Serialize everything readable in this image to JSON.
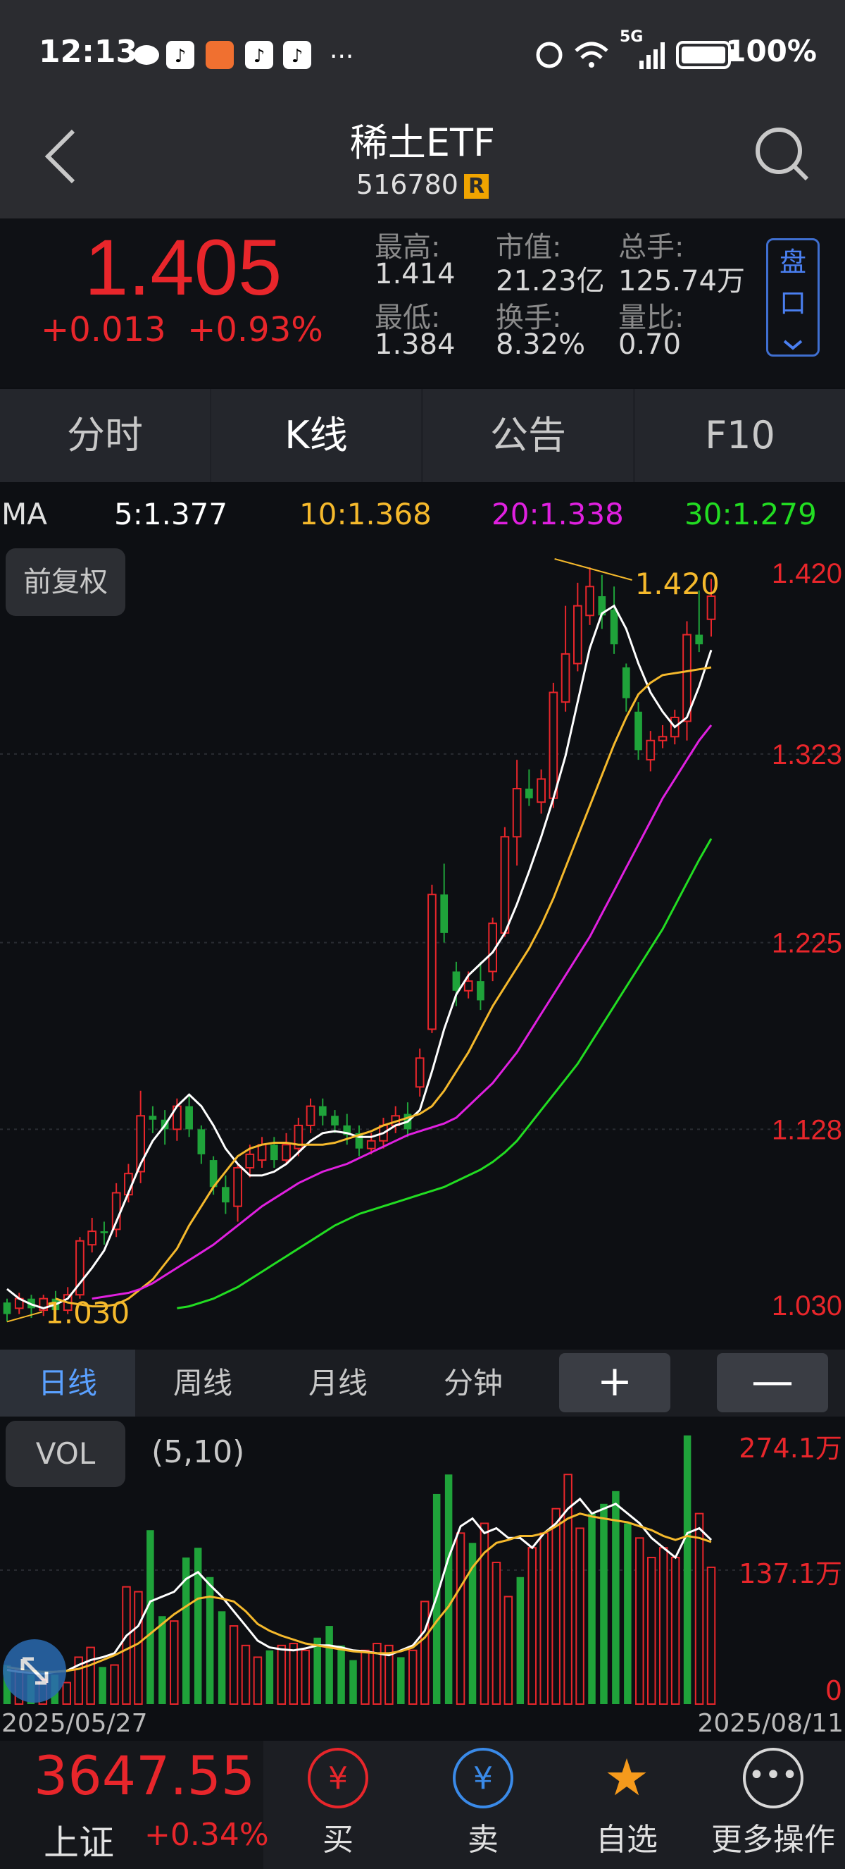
{
  "status_bar": {
    "time": "12:13",
    "network": "5G",
    "battery": "100%"
  },
  "nav": {
    "title": "稀土ETF",
    "code": "516780",
    "badge": "R"
  },
  "quote": {
    "price": "1.405",
    "change": "+0.013",
    "change_pct": "+0.93%",
    "stats": [
      {
        "label": "最高:",
        "value": "1.414"
      },
      {
        "label": "市值:",
        "value": "21.23亿"
      },
      {
        "label": "总手:",
        "value": "125.74万"
      },
      {
        "label": "最低:",
        "value": "1.384"
      },
      {
        "label": "换手:",
        "value": "8.32%"
      },
      {
        "label": "量比:",
        "value": "0.70"
      }
    ],
    "pankou": "盘口"
  },
  "tabs": [
    "分时",
    "K线",
    "公告",
    "F10"
  ],
  "ma": {
    "label": "MA",
    "ma5": "5:1.377",
    "ma10": "10:1.368",
    "ma20": "20:1.338",
    "ma30": "30:1.279"
  },
  "adjust": "前复权",
  "price_axis": [
    "1.420",
    "1.323",
    "1.225",
    "1.128",
    "1.030"
  ],
  "annotations": {
    "high": "1.420",
    "low": "1.030"
  },
  "period_tabs": [
    "日线",
    "周线",
    "月线",
    "分钟"
  ],
  "zoom": {
    "in": "+",
    "out": "—"
  },
  "vol": {
    "label": "VOL",
    "param": "(5,10)",
    "axis": [
      "274.1万",
      "137.1万",
      "0"
    ]
  },
  "dates": {
    "start": "2025/05/27",
    "end": "2025/08/11"
  },
  "index": {
    "value": "3647.55",
    "name": "上证",
    "change": "+0.34%"
  },
  "actions": [
    {
      "label": "买"
    },
    {
      "label": "卖"
    },
    {
      "label": "自选"
    },
    {
      "label": "更多操作"
    }
  ],
  "colors": {
    "up": "#e8262b",
    "down": "#1fa33a",
    "ma5": "#ffffff",
    "ma10": "#f5b92c",
    "ma20": "#e020e0",
    "ma30": "#22dd22"
  },
  "chart_data": {
    "type": "candlestick",
    "ylim": [
      1.03,
      1.42
    ],
    "candles": [
      {
        "o": 1.038,
        "c": 1.032,
        "h": 1.04,
        "l": 1.028
      },
      {
        "o": 1.035,
        "c": 1.04,
        "h": 1.043,
        "l": 1.032
      },
      {
        "o": 1.04,
        "c": 1.035,
        "h": 1.042,
        "l": 1.03
      },
      {
        "o": 1.034,
        "c": 1.04,
        "h": 1.042,
        "l": 1.031
      },
      {
        "o": 1.04,
        "c": 1.034,
        "h": 1.044,
        "l": 1.031
      },
      {
        "o": 1.034,
        "c": 1.042,
        "h": 1.046,
        "l": 1.032
      },
      {
        "o": 1.042,
        "c": 1.07,
        "h": 1.072,
        "l": 1.04
      },
      {
        "o": 1.068,
        "c": 1.075,
        "h": 1.082,
        "l": 1.064
      },
      {
        "o": 1.075,
        "c": 1.074,
        "h": 1.08,
        "l": 1.068
      },
      {
        "o": 1.076,
        "c": 1.095,
        "h": 1.1,
        "l": 1.072
      },
      {
        "o": 1.094,
        "c": 1.105,
        "h": 1.11,
        "l": 1.09
      },
      {
        "o": 1.106,
        "c": 1.135,
        "h": 1.148,
        "l": 1.1
      },
      {
        "o": 1.135,
        "c": 1.133,
        "h": 1.14,
        "l": 1.126
      },
      {
        "o": 1.133,
        "c": 1.128,
        "h": 1.138,
        "l": 1.12
      },
      {
        "o": 1.128,
        "c": 1.14,
        "h": 1.144,
        "l": 1.122
      },
      {
        "o": 1.14,
        "c": 1.128,
        "h": 1.145,
        "l": 1.124
      },
      {
        "o": 1.128,
        "c": 1.115,
        "h": 1.13,
        "l": 1.11
      },
      {
        "o": 1.112,
        "c": 1.098,
        "h": 1.114,
        "l": 1.094
      },
      {
        "o": 1.098,
        "c": 1.09,
        "h": 1.104,
        "l": 1.084
      },
      {
        "o": 1.088,
        "c": 1.108,
        "h": 1.11,
        "l": 1.08
      },
      {
        "o": 1.108,
        "c": 1.115,
        "h": 1.12,
        "l": 1.103
      },
      {
        "o": 1.112,
        "c": 1.12,
        "h": 1.124,
        "l": 1.108
      },
      {
        "o": 1.12,
        "c": 1.112,
        "h": 1.124,
        "l": 1.108
      },
      {
        "o": 1.112,
        "c": 1.12,
        "h": 1.126,
        "l": 1.11
      },
      {
        "o": 1.118,
        "c": 1.13,
        "h": 1.134,
        "l": 1.114
      },
      {
        "o": 1.13,
        "c": 1.14,
        "h": 1.144,
        "l": 1.126
      },
      {
        "o": 1.14,
        "c": 1.135,
        "h": 1.144,
        "l": 1.13
      },
      {
        "o": 1.135,
        "c": 1.13,
        "h": 1.138,
        "l": 1.126
      },
      {
        "o": 1.13,
        "c": 1.125,
        "h": 1.136,
        "l": 1.12
      },
      {
        "o": 1.126,
        "c": 1.118,
        "h": 1.13,
        "l": 1.114
      },
      {
        "o": 1.118,
        "c": 1.122,
        "h": 1.126,
        "l": 1.115
      },
      {
        "o": 1.122,
        "c": 1.13,
        "h": 1.134,
        "l": 1.118
      },
      {
        "o": 1.13,
        "c": 1.135,
        "h": 1.14,
        "l": 1.126
      },
      {
        "o": 1.136,
        "c": 1.128,
        "h": 1.142,
        "l": 1.124
      },
      {
        "o": 1.15,
        "c": 1.165,
        "h": 1.17,
        "l": 1.145
      },
      {
        "o": 1.18,
        "c": 1.25,
        "h": 1.255,
        "l": 1.178
      },
      {
        "o": 1.25,
        "c": 1.23,
        "h": 1.266,
        "l": 1.225
      },
      {
        "o": 1.21,
        "c": 1.2,
        "h": 1.215,
        "l": 1.192
      },
      {
        "o": 1.2,
        "c": 1.205,
        "h": 1.21,
        "l": 1.196
      },
      {
        "o": 1.205,
        "c": 1.195,
        "h": 1.215,
        "l": 1.19
      },
      {
        "o": 1.21,
        "c": 1.235,
        "h": 1.238,
        "l": 1.205
      },
      {
        "o": 1.23,
        "c": 1.28,
        "h": 1.285,
        "l": 1.228
      },
      {
        "o": 1.28,
        "c": 1.305,
        "h": 1.32,
        "l": 1.265
      },
      {
        "o": 1.305,
        "c": 1.3,
        "h": 1.315,
        "l": 1.296
      },
      {
        "o": 1.298,
        "c": 1.31,
        "h": 1.315,
        "l": 1.292
      },
      {
        "o": 1.3,
        "c": 1.355,
        "h": 1.36,
        "l": 1.295
      },
      {
        "o": 1.35,
        "c": 1.375,
        "h": 1.4,
        "l": 1.345
      },
      {
        "o": 1.37,
        "c": 1.4,
        "h": 1.412,
        "l": 1.366
      },
      {
        "o": 1.395,
        "c": 1.41,
        "h": 1.42,
        "l": 1.39
      },
      {
        "o": 1.405,
        "c": 1.395,
        "h": 1.416,
        "l": 1.388
      },
      {
        "o": 1.398,
        "c": 1.38,
        "h": 1.41,
        "l": 1.375
      },
      {
        "o": 1.368,
        "c": 1.352,
        "h": 1.37,
        "l": 1.345
      },
      {
        "o": 1.345,
        "c": 1.325,
        "h": 1.35,
        "l": 1.32
      },
      {
        "o": 1.32,
        "c": 1.33,
        "h": 1.335,
        "l": 1.314
      },
      {
        "o": 1.33,
        "c": 1.332,
        "h": 1.338,
        "l": 1.326
      },
      {
        "o": 1.332,
        "c": 1.342,
        "h": 1.346,
        "l": 1.328
      },
      {
        "o": 1.34,
        "c": 1.385,
        "h": 1.392,
        "l": 1.33
      },
      {
        "o": 1.385,
        "c": 1.38,
        "h": 1.408,
        "l": 1.376
      },
      {
        "o": 1.393,
        "c": 1.405,
        "h": 1.414,
        "l": 1.384
      }
    ],
    "ma5": [
      1.045,
      1.04,
      1.037,
      1.035,
      1.037,
      1.04,
      1.048,
      1.056,
      1.065,
      1.08,
      1.095,
      1.11,
      1.122,
      1.13,
      1.14,
      1.146,
      1.14,
      1.13,
      1.118,
      1.11,
      1.104,
      1.104,
      1.106,
      1.11,
      1.116,
      1.122,
      1.126,
      1.127,
      1.126,
      1.124,
      1.124,
      1.126,
      1.13,
      1.132,
      1.138,
      1.158,
      1.18,
      1.198,
      1.208,
      1.214,
      1.22,
      1.23,
      1.245,
      1.262,
      1.28,
      1.3,
      1.322,
      1.35,
      1.378,
      1.396,
      1.4,
      1.388,
      1.37,
      1.355,
      1.345,
      1.337,
      1.342,
      1.358,
      1.377
    ],
    "ma10": [
      1.04,
      1.038,
      1.037,
      1.036,
      1.036,
      1.037,
      1.04,
      1.045,
      1.05,
      1.058,
      1.066,
      1.078,
      1.088,
      1.098,
      1.106,
      1.114,
      1.118,
      1.12,
      1.121,
      1.121,
      1.12,
      1.12,
      1.12,
      1.121,
      1.123,
      1.125,
      1.127,
      1.13,
      1.132,
      1.134,
      1.136,
      1.14,
      1.148,
      1.158,
      1.168,
      1.18,
      1.192,
      1.202,
      1.212,
      1.222,
      1.234,
      1.248,
      1.264,
      1.28,
      1.296,
      1.312,
      1.328,
      1.342,
      1.354,
      1.36,
      1.364,
      1.365,
      1.366,
      1.367,
      1.368
    ],
    "ma20": [
      1.04,
      1.041,
      1.042,
      1.043,
      1.045,
      1.048,
      1.052,
      1.056,
      1.06,
      1.064,
      1.068,
      1.073,
      1.078,
      1.083,
      1.088,
      1.092,
      1.096,
      1.1,
      1.103,
      1.106,
      1.108,
      1.11,
      1.113,
      1.116,
      1.119,
      1.122,
      1.125,
      1.127,
      1.129,
      1.131,
      1.134,
      1.14,
      1.146,
      1.152,
      1.16,
      1.168,
      1.178,
      1.188,
      1.198,
      1.208,
      1.218,
      1.228,
      1.24,
      1.252,
      1.264,
      1.276,
      1.288,
      1.3,
      1.31,
      1.32,
      1.33,
      1.338
    ],
    "ma30": [
      1.035,
      1.036,
      1.038,
      1.04,
      1.043,
      1.046,
      1.05,
      1.054,
      1.058,
      1.062,
      1.066,
      1.07,
      1.074,
      1.078,
      1.081,
      1.084,
      1.086,
      1.088,
      1.09,
      1.092,
      1.094,
      1.096,
      1.098,
      1.101,
      1.104,
      1.107,
      1.111,
      1.116,
      1.122,
      1.13,
      1.138,
      1.146,
      1.154,
      1.162,
      1.172,
      1.182,
      1.192,
      1.202,
      1.212,
      1.222,
      1.232,
      1.244,
      1.256,
      1.268,
      1.279
    ],
    "volume": {
      "unit": "万",
      "ylim": [
        0,
        274.1
      ],
      "values": [
        40,
        35,
        30,
        25,
        30,
        22,
        48,
        58,
        38,
        40,
        120,
        115,
        178,
        90,
        85,
        150,
        160,
        130,
        95,
        80,
        60,
        48,
        55,
        60,
        62,
        55,
        68,
        80,
        60,
        45,
        55,
        62,
        60,
        48,
        55,
        105,
        215,
        235,
        175,
        165,
        185,
        145,
        110,
        130,
        160,
        175,
        200,
        235,
        180,
        195,
        205,
        218,
        185,
        170,
        150,
        160,
        150,
        275,
        195,
        140
      ],
      "ma5": [
        35,
        33,
        32,
        31,
        33,
        34,
        40,
        45,
        48,
        52,
        70,
        80,
        105,
        110,
        115,
        128,
        135,
        122,
        110,
        95,
        80,
        65,
        58,
        56,
        55,
        57,
        60,
        60,
        58,
        55,
        54,
        52,
        50,
        55,
        60,
        75,
        110,
        150,
        182,
        190,
        175,
        180,
        170,
        170,
        160,
        175,
        185,
        200,
        210,
        195,
        200,
        205,
        195,
        185,
        170,
        160,
        150,
        175,
        180,
        168
      ],
      "ma10": [
        38,
        36,
        34,
        33,
        33,
        34,
        36,
        40,
        45,
        50,
        56,
        62,
        72,
        82,
        92,
        100,
        108,
        110,
        108,
        105,
        95,
        82,
        75,
        70,
        66,
        62,
        60,
        58,
        56,
        54,
        53,
        52,
        52,
        54,
        58,
        68,
        85,
        100,
        120,
        140,
        155,
        165,
        168,
        172,
        172,
        175,
        182,
        190,
        195,
        192,
        190,
        188,
        186,
        182,
        178,
        172,
        168,
        172,
        170,
        166
      ]
    }
  }
}
